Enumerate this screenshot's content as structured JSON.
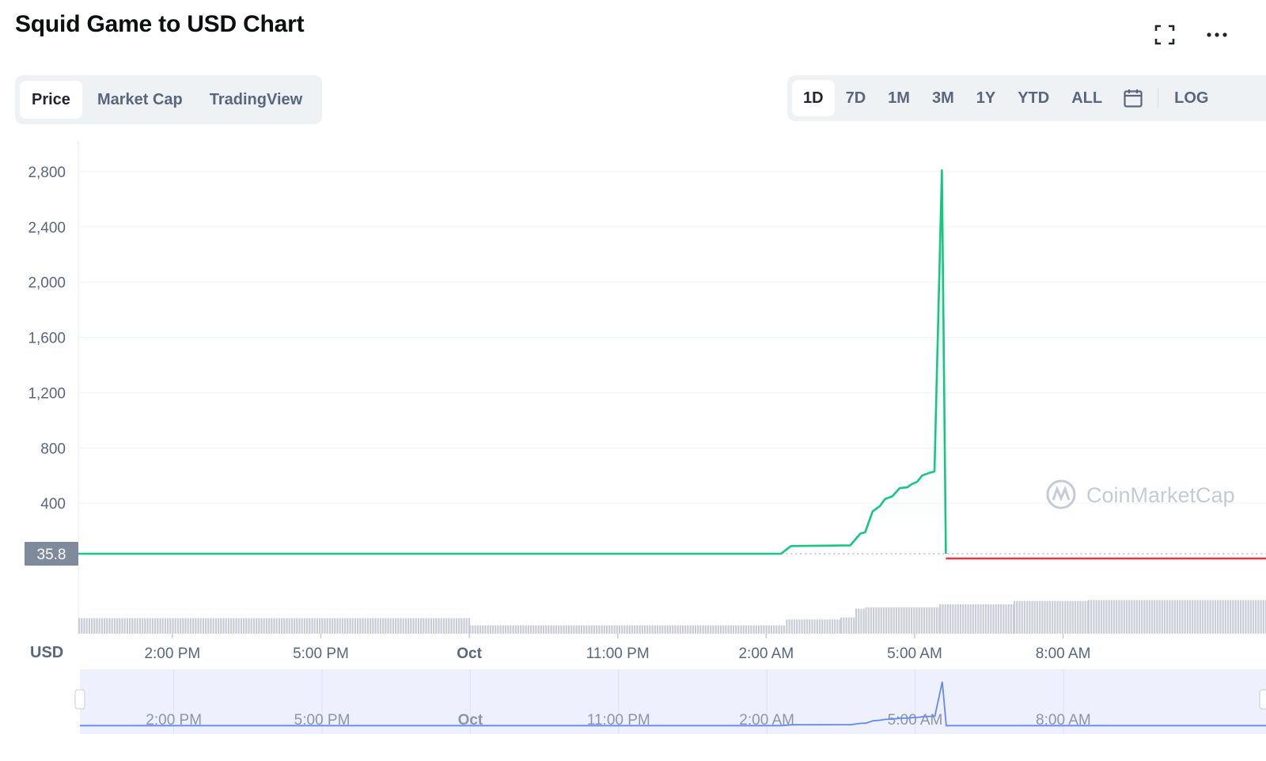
{
  "header": {
    "title": "Squid Game to USD Chart"
  },
  "icons": {
    "fullscreen": "fullscreen-icon",
    "more": "more-options-icon",
    "calendar": "calendar-icon"
  },
  "view_tabs": [
    {
      "label": "Price",
      "active": true
    },
    {
      "label": "Market Cap",
      "active": false
    },
    {
      "label": "TradingView",
      "active": false
    }
  ],
  "time_ranges": [
    {
      "label": "1D",
      "active": true
    },
    {
      "label": "7D",
      "active": false
    },
    {
      "label": "1M",
      "active": false
    },
    {
      "label": "3M",
      "active": false
    },
    {
      "label": "1Y",
      "active": false
    },
    {
      "label": "YTD",
      "active": false
    },
    {
      "label": "ALL",
      "active": false
    }
  ],
  "log_label": "LOG",
  "watermark": "CoinMarketCap",
  "colors": {
    "up": "#16c784",
    "down": "#ea3943",
    "navigator_line": "#6188ff",
    "navigator_fill": "#eef1fd",
    "price_badge": "#808a9d"
  },
  "chart_data": {
    "type": "line",
    "currency_label": "USD",
    "current_price_label": "35.8",
    "y_ticks": [
      "2,800",
      "2,400",
      "2,000",
      "1,600",
      "1,200",
      "800",
      "400"
    ],
    "ylim": [
      0,
      3000
    ],
    "x_ticks": [
      "2:00 PM",
      "5:00 PM",
      "Oct",
      "11:00 PM",
      "2:00 AM",
      "5:00 AM",
      "8:00 AM"
    ],
    "x_tick_hours": [
      14,
      17,
      20,
      23,
      26,
      29,
      32
    ],
    "xlim_hours": [
      12.1,
      36.1
    ],
    "series": [
      {
        "color_role": "up",
        "points": [
          [
            12.1,
            35.8
          ],
          [
            26.3,
            35.8
          ],
          [
            26.5,
            90
          ],
          [
            27.7,
            95
          ],
          [
            27.9,
            180
          ],
          [
            28.0,
            190
          ],
          [
            28.15,
            340
          ],
          [
            28.3,
            380
          ],
          [
            28.4,
            430
          ],
          [
            28.55,
            450
          ],
          [
            28.7,
            510
          ],
          [
            28.85,
            515
          ],
          [
            28.95,
            540
          ],
          [
            29.05,
            555
          ],
          [
            29.15,
            600
          ],
          [
            29.3,
            620
          ],
          [
            29.4,
            630
          ],
          [
            29.55,
            2810
          ],
          [
            29.63,
            35.8
          ]
        ]
      },
      {
        "color_role": "down",
        "points": [
          [
            29.63,
            0
          ],
          [
            36.1,
            0
          ]
        ]
      }
    ],
    "volume": [
      {
        "from": 12.1,
        "to": 20.0,
        "level": 0.53
      },
      {
        "from": 20.0,
        "to": 26.4,
        "level": 0.28
      },
      {
        "from": 26.4,
        "to": 27.5,
        "level": 0.48
      },
      {
        "from": 27.5,
        "to": 27.8,
        "level": 0.55
      },
      {
        "from": 27.8,
        "to": 28.0,
        "level": 0.85
      },
      {
        "from": 28.0,
        "to": 29.5,
        "level": 0.9
      },
      {
        "from": 29.5,
        "to": 31.0,
        "level": 1.0
      },
      {
        "from": 31.0,
        "to": 32.5,
        "level": 1.12
      },
      {
        "from": 32.5,
        "to": 36.1,
        "level": 1.15
      }
    ]
  }
}
